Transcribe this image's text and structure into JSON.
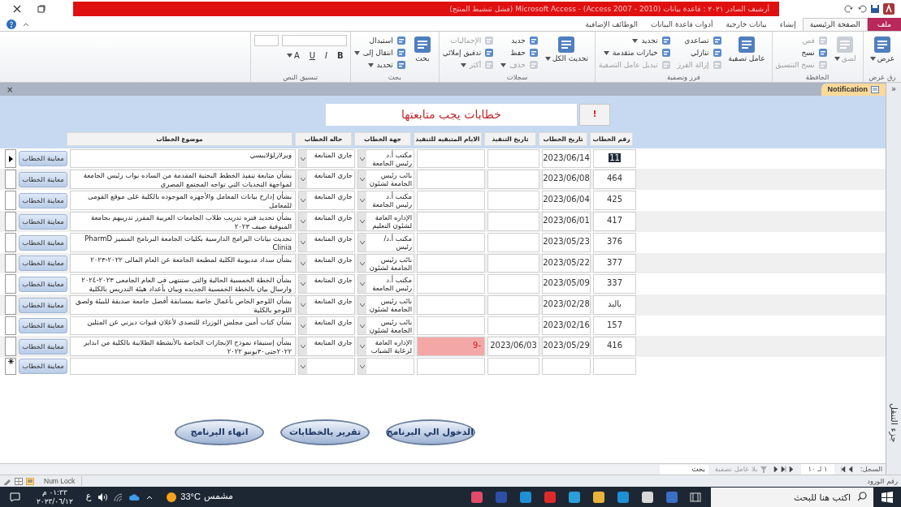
{
  "window": {
    "title": "أرشيف الصادر ٢٠٢١ : قاعدة بيانات (Access 2007 - 2010) - Microsoft Access (فشل تنشيط المنتج)"
  },
  "ribbon": {
    "tabs": [
      {
        "label": "ملف",
        "kind": "file",
        "selected": false
      },
      {
        "label": "الصفحة الرئيسية",
        "kind": "tab",
        "selected": true
      },
      {
        "label": "إنشاء",
        "kind": "tab",
        "selected": false
      },
      {
        "label": "بيانات خارجية",
        "kind": "tab",
        "selected": false
      },
      {
        "label": "أدوات قاعدة البيانات",
        "kind": "tab",
        "selected": false
      },
      {
        "label": "الوظائف الإضافية",
        "kind": "tab",
        "selected": false
      }
    ],
    "groups": [
      {
        "label": "رق عرض",
        "items": [
          {
            "label": "عرض",
            "kind": "large",
            "disabled": false,
            "dropdown": true
          }
        ]
      },
      {
        "label": "الحافظة",
        "items": [
          {
            "label": "لصق",
            "kind": "large",
            "disabled": true,
            "dropdown": true
          },
          {
            "label": "قص",
            "kind": "small",
            "disabled": true,
            "dropdown": false
          },
          {
            "label": "نسخ",
            "kind": "small",
            "disabled": false,
            "dropdown": false
          },
          {
            "label": "نسخ التنسيق",
            "kind": "small",
            "disabled": true,
            "dropdown": false
          }
        ]
      },
      {
        "label": "فرز وتصفية",
        "items": [
          {
            "label": "عامل تصفية",
            "kind": "large",
            "disabled": false,
            "dropdown": false
          },
          {
            "label": "تصاعدي",
            "kind": "small",
            "disabled": false,
            "dropdown": false
          },
          {
            "label": "تنازلي",
            "kind": "small",
            "disabled": false,
            "dropdown": false
          },
          {
            "label": "إزالة الفرز",
            "kind": "small",
            "disabled": true,
            "dropdown": false
          },
          {
            "label": "تحديد",
            "kind": "small",
            "disabled": false,
            "dropdown": true
          },
          {
            "label": "خيارات متقدمة",
            "kind": "small",
            "disabled": false,
            "dropdown": true
          },
          {
            "label": "تبديل عامل التصفية",
            "kind": "small",
            "disabled": true,
            "dropdown": false
          }
        ]
      },
      {
        "label": "سجلات",
        "items": [
          {
            "label": "تحديث الكل",
            "kind": "large",
            "disabled": false,
            "dropdown": true
          },
          {
            "label": "جديد",
            "kind": "small",
            "disabled": false,
            "dropdown": false
          },
          {
            "label": "حفظ",
            "kind": "small",
            "disabled": false,
            "dropdown": false
          },
          {
            "label": "حذف",
            "kind": "small",
            "disabled": true,
            "dropdown": true
          },
          {
            "label": "الإجماليات",
            "kind": "small",
            "disabled": true,
            "dropdown": false
          },
          {
            "label": "تدقيق إملائي",
            "kind": "small",
            "disabled": false,
            "dropdown": false
          },
          {
            "label": "أكثر",
            "kind": "small",
            "disabled": true,
            "dropdown": true
          }
        ]
      },
      {
        "label": "بحث",
        "items": [
          {
            "label": "بحث",
            "kind": "large",
            "disabled": false,
            "dropdown": false
          },
          {
            "label": "استبدال",
            "kind": "small",
            "disabled": false,
            "dropdown": false
          },
          {
            "label": "انتقال إلى",
            "kind": "small",
            "disabled": false,
            "dropdown": true
          },
          {
            "label": "تحديد",
            "kind": "small",
            "disabled": false,
            "dropdown": true
          }
        ]
      },
      {
        "label": "تنسيق النص",
        "items": [
          {
            "label": "B",
            "kind": "glyph",
            "disabled": false,
            "dropdown": false
          },
          {
            "label": "I",
            "kind": "glyph",
            "disabled": false,
            "dropdown": false
          },
          {
            "label": "U",
            "kind": "glyph",
            "disabled": false,
            "dropdown": false
          },
          {
            "label": "A",
            "kind": "glyph",
            "disabled": false,
            "dropdown": true
          }
        ]
      }
    ]
  },
  "document_tabs": {
    "close": "×",
    "tabs": [
      {
        "label": "Notification",
        "selected": true
      }
    ]
  },
  "navigation_pane": {
    "toggle": "«",
    "label": "جزء التنقل"
  },
  "form": {
    "title": "خطابات يجب متابعتها",
    "alert_button": "!",
    "columns": [
      "رقم الخطاب",
      "تاريخ الخطاب",
      "تاريخ التنفيذ",
      "الايام المتبقيه للتنفيذ",
      "جهة الخطاب",
      "حاله الخطاب",
      "موضوع الخطاب"
    ],
    "rows": [
      {
        "number": "11",
        "date": "2023/06/14",
        "exec_date": "",
        "remaining": "",
        "overdue": false,
        "entity": "مكتب أ.د رئيس الجامعة",
        "status": "جاري المتابعة",
        "subject": "وبرلارلؤلايبسي",
        "button": "معاينة الخطاب",
        "current": true
      },
      {
        "number": "464",
        "date": "2023/06/08",
        "exec_date": "",
        "remaining": "",
        "overdue": false,
        "entity": "نائب رئيس الجامعة لشئون",
        "status": "جاري المتابعة",
        "subject": "بشأن متابعة تنفيذ الخطط البحثية المقدمة من الساده نواب رئيس الجامعة  لمواجهة التحديات التي تواجه المجتمع المصري",
        "button": "معاينة الخطاب",
        "current": false
      },
      {
        "number": "425",
        "date": "2023/06/04",
        "exec_date": "",
        "remaining": "",
        "overdue": false,
        "entity": "مكتب أ.د رئيس الجامعة",
        "status": "جاري المتابعة",
        "subject": "بشأن إدارج بيانات المعامل والأجهزه الموجوده بالكلية على موقع القومى للمعامل",
        "button": "معاينة الخطاب",
        "current": false
      },
      {
        "number": "417",
        "date": "2023/06/01",
        "exec_date": "",
        "remaining": "",
        "overdue": false,
        "entity": "الإداره العامة لشئون التعليم",
        "status": "جاري المتابعة",
        "subject": "بشأن تحديد فتره تدريب طلاب الجامعات العربية المقرر تدريبهم بجامعة المنوفية صيف ٢٠٢٣",
        "button": "معاينة الخطاب",
        "current": false
      },
      {
        "number": "376",
        "date": "2023/05/23",
        "exec_date": "",
        "remaining": "",
        "overdue": false,
        "entity": "مكتب أ.د/ رئيس",
        "status": "جاري المتابعة",
        "subject": "تحديث بيانات البرامج الدارسية بكليات الجامعة البرنامج المتميز PharmD Clinia",
        "button": "معاينة الخطاب",
        "current": false
      },
      {
        "number": "377",
        "date": "2023/05/22",
        "exec_date": "",
        "remaining": "",
        "overdue": false,
        "entity": "نائب رئيس الجامعة لشئون",
        "status": "جاري المتابعة",
        "subject": "بشأن  سداد مديونية الكلية لمطبعة الجامعة عن العام المالى ٢٠٢٢-٢٠٢٣",
        "button": "معاينة الخطاب",
        "current": false
      },
      {
        "number": "337",
        "date": "2023/05/09",
        "exec_date": "",
        "remaining": "",
        "overdue": false,
        "entity": "مكتب أ.د رئيس الجامعة",
        "status": "جاري المتابعة",
        "subject": "بشأن  الخطة الخمسية الحالية والتى ستنتهى فى العام الجامعى ٢٠٢٣-٢٠٢٤ وارسال بيان بالخطة الخمسية الجديده وبيان بأعداد هيئة التدريس بالكلية",
        "button": "معاينة الخطاب",
        "current": false
      },
      {
        "number": "باليد",
        "date": "2023/02/28",
        "exec_date": "",
        "remaining": "",
        "overdue": false,
        "entity": "نائب رئيس الجامعة لشئون",
        "status": "جاري المتابعة",
        "subject": "بشأن اللوجو الخاص بأعمال خاصة بمسابقة أفضل جامعة صديقة للبيئة ولصق اللوجو بالكلية",
        "button": "معاينة الخطاب",
        "current": false
      },
      {
        "number": "157",
        "date": "2023/02/16",
        "exec_date": "",
        "remaining": "",
        "overdue": false,
        "entity": "نائب رئيس الجامعة لشئون",
        "status": "جاري المتابعة",
        "subject": "بشأن كتاب أمين مجلس الوزراء للتصدى لأعلان قنوات ديزني عن المثلين",
        "button": "معاينة الخطاب",
        "current": false
      },
      {
        "number": "416",
        "date": "2023/05/29",
        "exec_date": "2023/06/03",
        "remaining": "-9",
        "overdue": true,
        "entity": "الإداره العامة لرعاية الشباب",
        "status": "جاري المتابعة",
        "subject": "بشأن إستيفاء نموذج الإنجازات الخاصة بالأنشطة الطلابية بالكلية من  ابداير ٢٠٢٢حتى٣٠يونيو ٢٠٢٢",
        "button": "معاينة الخطاب",
        "current": false
      }
    ],
    "new_row": {
      "button": "معاينة الخطاب"
    },
    "actions": [
      "الدخول الي البرنامج",
      "تقرير بالخطابات",
      "انهاء البرنامج"
    ]
  },
  "record_nav": {
    "label": "السجل:",
    "position": "١ لـ ١٠",
    "filter": "بلا عامل تصفية",
    "search_placeholder": "بحث"
  },
  "status_bar": {
    "left": "Num Lock",
    "right": "رقم الورود"
  },
  "taskbar": {
    "search_placeholder": "اكتب هنا للبحث",
    "condition": "مشمس",
    "temperature": "33°C",
    "language": "ع",
    "time": "٠١:٣٣ م",
    "date": "٢٠٢٣/٠٦/١٢"
  }
}
